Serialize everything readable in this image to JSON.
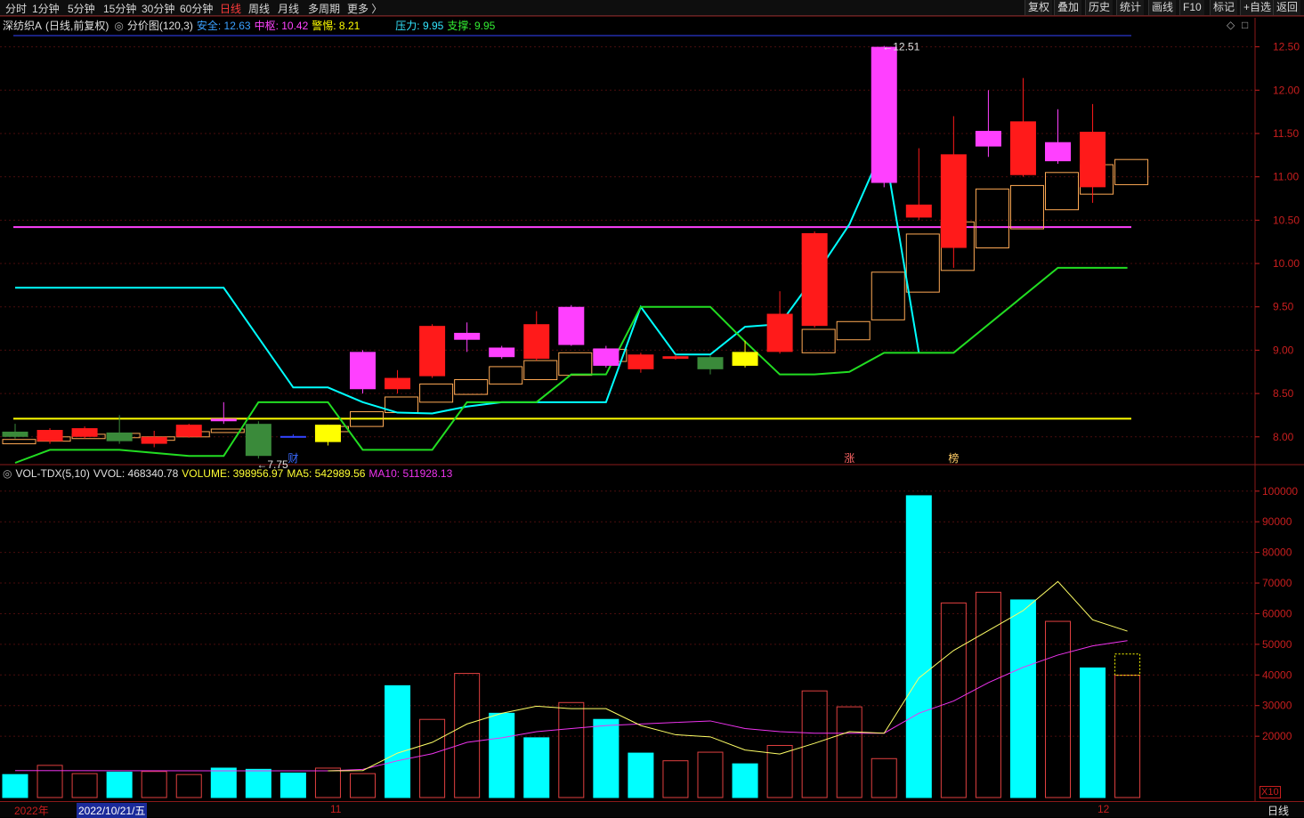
{
  "periods": [
    "分时",
    "1分钟",
    "5分钟",
    "15分钟",
    "30分钟",
    "60分钟",
    "日线",
    "周线",
    "月线",
    "多周期",
    "更多 〉"
  ],
  "active_period": "日线",
  "tools": [
    "复权",
    "叠加",
    "历史",
    "统计",
    "画线",
    "F10",
    "标记",
    "+自选",
    "返回"
  ],
  "info": {
    "stock": "深纺织A",
    "adjust": "(日线,前复权)",
    "indicator": "分价图(120,3)",
    "safe_label": "安全: 12.63",
    "mid_label": "中枢: 10.42",
    "warn_label": "警惕: 8.21",
    "press_label": "压力: 9.95",
    "support_label": "支撑: 9.95"
  },
  "vol_info": {
    "name": "VOL-TDX(5,10)",
    "vvol": "VVOL: 468340.78",
    "volume": "VOLUME: 398956.97",
    "ma5": "MA5: 542989.56",
    "ma10": "MA10: 511928.13"
  },
  "dates": {
    "year": "2022年",
    "selected": "2022/10/21/五",
    "nov": "11",
    "dec": "12"
  },
  "corner": {
    "multiplier": "X10",
    "period": "日线"
  },
  "colors": {
    "up": "#ff1a1a",
    "down": "#3a8a3a",
    "magenta": "#ff40ff",
    "yellow": "#ffff00",
    "cyan": "#00ffff",
    "green": "#22dd22",
    "blue": "#3344ff",
    "ma5": "#ffff66",
    "ma10": "#ee33ee",
    "box": "#ffaa55"
  },
  "chart_data": {
    "type": "candlestick",
    "price_axis": {
      "ylim": [
        7.7,
        12.65
      ],
      "ticks": [
        "12.50",
        "12.00",
        "11.50",
        "11.00",
        "10.50",
        "10.00",
        "9.50",
        "9.00",
        "8.50",
        "8.00"
      ]
    },
    "volume_axis": {
      "ylim": [
        0,
        104000
      ],
      "ticks": [
        "100000",
        "90000",
        "80000",
        "70000",
        "60000",
        "50000",
        "40000",
        "30000",
        "20000"
      ]
    },
    "levels": {
      "safe": 12.63,
      "mid": 10.42,
      "warn": 8.21
    },
    "annotations": {
      "low": "←7.75",
      "high": "←12.51",
      "markers": [
        "财",
        "涨",
        "榜"
      ]
    },
    "candles": [
      {
        "o": 8.0,
        "c": 8.06,
        "h": 8.15,
        "l": 7.98,
        "color": "down"
      },
      {
        "o": 7.95,
        "c": 8.08,
        "h": 8.1,
        "l": 7.92,
        "color": "up"
      },
      {
        "o": 8.0,
        "c": 8.1,
        "h": 8.12,
        "l": 7.98,
        "color": "up"
      },
      {
        "o": 8.05,
        "c": 7.95,
        "h": 8.25,
        "l": 7.92,
        "color": "down"
      },
      {
        "o": 7.92,
        "c": 8.0,
        "h": 8.07,
        "l": 7.88,
        "color": "up"
      },
      {
        "o": 8.0,
        "c": 8.14,
        "h": 8.15,
        "l": 7.99,
        "color": "up"
      },
      {
        "o": 8.18,
        "c": 8.21,
        "h": 8.4,
        "l": 8.15,
        "color": "magenta"
      },
      {
        "o": 8.15,
        "c": 7.78,
        "h": 8.18,
        "l": 7.75,
        "color": "down"
      },
      {
        "o": 8.0,
        "c": 8.01,
        "h": 8.03,
        "l": 7.99,
        "color": "blue"
      },
      {
        "o": 7.94,
        "c": 8.14,
        "h": 8.14,
        "l": 7.9,
        "color": "yellow"
      },
      {
        "o": 8.55,
        "c": 8.98,
        "h": 9.0,
        "l": 8.5,
        "color": "magenta"
      },
      {
        "o": 8.55,
        "c": 8.68,
        "h": 8.77,
        "l": 8.5,
        "color": "up"
      },
      {
        "o": 8.7,
        "c": 9.28,
        "h": 9.3,
        "l": 8.68,
        "color": "up"
      },
      {
        "o": 9.12,
        "c": 9.2,
        "h": 9.32,
        "l": 8.98,
        "color": "magenta"
      },
      {
        "o": 8.92,
        "c": 9.03,
        "h": 9.05,
        "l": 8.9,
        "color": "magenta"
      },
      {
        "o": 8.9,
        "c": 9.3,
        "h": 9.45,
        "l": 8.88,
        "color": "up"
      },
      {
        "o": 9.06,
        "c": 9.5,
        "h": 9.52,
        "l": 9.05,
        "color": "magenta"
      },
      {
        "o": 8.82,
        "c": 9.02,
        "h": 9.05,
        "l": 8.8,
        "color": "magenta"
      },
      {
        "o": 8.78,
        "c": 8.95,
        "h": 8.97,
        "l": 8.74,
        "color": "up"
      },
      {
        "o": 8.9,
        "c": 8.93,
        "h": 8.95,
        "l": 8.89,
        "color": "up"
      },
      {
        "o": 8.92,
        "c": 8.78,
        "h": 8.94,
        "l": 8.72,
        "color": "down"
      },
      {
        "o": 8.82,
        "c": 8.98,
        "h": 9.11,
        "l": 8.8,
        "color": "yellow"
      },
      {
        "o": 8.98,
        "c": 9.42,
        "h": 9.68,
        "l": 8.96,
        "color": "up"
      },
      {
        "o": 9.28,
        "c": 10.35,
        "h": 10.37,
        "l": 9.26,
        "color": "up"
      },
      {
        "o": 9.5,
        "c": 9.5,
        "h": 9.5,
        "l": 9.5,
        "color": "none"
      },
      {
        "o": 10.93,
        "c": 12.5,
        "h": 12.51,
        "l": 10.88,
        "color": "magenta"
      },
      {
        "o": 10.53,
        "c": 10.68,
        "h": 11.33,
        "l": 10.5,
        "color": "up"
      },
      {
        "o": 10.18,
        "c": 11.26,
        "h": 11.7,
        "l": 9.95,
        "color": "up"
      },
      {
        "o": 11.35,
        "c": 11.53,
        "h": 12.0,
        "l": 11.23,
        "color": "magenta"
      },
      {
        "o": 11.02,
        "c": 11.64,
        "h": 12.14,
        "l": 11.0,
        "color": "up"
      },
      {
        "o": 11.18,
        "c": 11.4,
        "h": 11.78,
        "l": 11.15,
        "color": "magenta"
      },
      {
        "o": 10.88,
        "c": 11.52,
        "h": 11.84,
        "l": 10.7,
        "color": "up"
      }
    ],
    "boxes": [
      {
        "lo": 7.92,
        "hi": 7.97
      },
      {
        "lo": 7.95,
        "hi": 8.0
      },
      {
        "lo": 7.98,
        "hi": 8.03
      },
      {
        "lo": 7.99,
        "hi": 8.04
      },
      {
        "lo": 7.96,
        "hi": 8.0
      },
      {
        "lo": 8.0,
        "hi": 8.06
      },
      {
        "lo": 8.05,
        "hi": 8.09
      },
      null,
      null,
      {
        "lo": 8.06,
        "hi": 8.12
      },
      {
        "lo": 8.12,
        "hi": 8.29
      },
      {
        "lo": 8.28,
        "hi": 8.46
      },
      {
        "lo": 8.4,
        "hi": 8.61
      },
      {
        "lo": 8.49,
        "hi": 8.66
      },
      {
        "lo": 8.61,
        "hi": 8.81
      },
      {
        "lo": 8.66,
        "hi": 8.88
      },
      {
        "lo": 8.71,
        "hi": 8.97
      },
      {
        "lo": 8.87,
        "hi": 9.01
      },
      null,
      null,
      null,
      null,
      null,
      {
        "lo": 8.97,
        "hi": 9.24
      },
      {
        "lo": 9.12,
        "hi": 9.33
      },
      {
        "lo": 9.35,
        "hi": 9.9
      },
      {
        "lo": 9.67,
        "hi": 10.34
      },
      {
        "lo": 9.92,
        "hi": 10.48
      },
      {
        "lo": 10.18,
        "hi": 10.86
      },
      {
        "lo": 10.4,
        "hi": 10.9
      },
      {
        "lo": 10.62,
        "hi": 11.05
      },
      {
        "lo": 10.8,
        "hi": 11.14
      },
      {
        "lo": 10.91,
        "hi": 11.2
      }
    ],
    "cyan_line": [
      {
        "x": 0,
        "y": 9.72
      },
      {
        "x": 6,
        "y": 9.72
      },
      {
        "x": 8,
        "y": 8.57
      },
      {
        "x": 9,
        "y": 8.57
      },
      {
        "x": 10,
        "y": 8.4
      },
      {
        "x": 11,
        "y": 8.28
      },
      {
        "x": 12,
        "y": 8.27
      },
      {
        "x": 13,
        "y": 8.35
      },
      {
        "x": 14,
        "y": 8.4
      },
      {
        "x": 15,
        "y": 8.4
      },
      {
        "x": 16,
        "y": 8.4
      },
      {
        "x": 17,
        "y": 8.4
      },
      {
        "x": 18,
        "y": 9.5
      },
      {
        "x": 19,
        "y": 8.95
      },
      {
        "x": 20,
        "y": 8.95
      },
      {
        "x": 21,
        "y": 9.27
      },
      {
        "x": 22,
        "y": 9.3
      },
      {
        "x": 23,
        "y": 9.85
      },
      {
        "x": 24,
        "y": 10.45
      },
      {
        "x": 25,
        "y": 11.36
      },
      {
        "x": 26,
        "y": 8.97
      }
    ],
    "green_line": [
      {
        "x": 0,
        "y": 7.7
      },
      {
        "x": 1,
        "y": 7.85
      },
      {
        "x": 3,
        "y": 7.85
      },
      {
        "x": 5,
        "y": 7.78
      },
      {
        "x": 6,
        "y": 7.78
      },
      {
        "x": 7,
        "y": 8.4
      },
      {
        "x": 9,
        "y": 8.4
      },
      {
        "x": 10,
        "y": 7.85
      },
      {
        "x": 12,
        "y": 7.85
      },
      {
        "x": 13,
        "y": 8.4
      },
      {
        "x": 15,
        "y": 8.4
      },
      {
        "x": 16,
        "y": 8.72
      },
      {
        "x": 17,
        "y": 8.72
      },
      {
        "x": 18,
        "y": 9.5
      },
      {
        "x": 20,
        "y": 9.5
      },
      {
        "x": 21,
        "y": 9.1
      },
      {
        "x": 22,
        "y": 8.72
      },
      {
        "x": 23,
        "y": 8.72
      },
      {
        "x": 24,
        "y": 8.75
      },
      {
        "x": 25,
        "y": 8.97
      },
      {
        "x": 26,
        "y": 8.97
      },
      {
        "x": 27,
        "y": 8.97
      },
      {
        "x": 30,
        "y": 9.95
      },
      {
        "x": 32,
        "y": 9.95
      }
    ],
    "volume": [
      {
        "v": 7500,
        "color": "cyan",
        "fill": true
      },
      {
        "v": 10500,
        "color": "red",
        "fill": false
      },
      {
        "v": 7800,
        "color": "red",
        "fill": false
      },
      {
        "v": 8300,
        "color": "cyan",
        "fill": true
      },
      {
        "v": 8500,
        "color": "red",
        "fill": false
      },
      {
        "v": 7500,
        "color": "red",
        "fill": false
      },
      {
        "v": 9600,
        "color": "cyan",
        "fill": true
      },
      {
        "v": 9200,
        "color": "cyan",
        "fill": true
      },
      {
        "v": 8000,
        "color": "cyan",
        "fill": true
      },
      {
        "v": 9600,
        "color": "red",
        "fill": false
      },
      {
        "v": 7800,
        "color": "red",
        "fill": false
      },
      {
        "v": 36500,
        "color": "cyan",
        "fill": true
      },
      {
        "v": 25500,
        "color": "red",
        "fill": false
      },
      {
        "v": 40500,
        "color": "red",
        "fill": false
      },
      {
        "v": 27500,
        "color": "cyan",
        "fill": true
      },
      {
        "v": 19500,
        "color": "cyan",
        "fill": true
      },
      {
        "v": 31000,
        "color": "red",
        "fill": false
      },
      {
        "v": 25500,
        "color": "cyan",
        "fill": true
      },
      {
        "v": 14500,
        "color": "cyan",
        "fill": true
      },
      {
        "v": 12000,
        "color": "red",
        "fill": false
      },
      {
        "v": 14800,
        "color": "red",
        "fill": false
      },
      {
        "v": 11000,
        "color": "cyan",
        "fill": true
      },
      {
        "v": 17000,
        "color": "red",
        "fill": false
      },
      {
        "v": 34800,
        "color": "red",
        "fill": false
      },
      {
        "v": 29600,
        "color": "red",
        "fill": false
      },
      {
        "v": 12700,
        "color": "red",
        "fill": false
      },
      {
        "v": 98500,
        "color": "cyan",
        "fill": true
      },
      {
        "v": 63500,
        "color": "red",
        "fill": false
      },
      {
        "v": 67000,
        "color": "red",
        "fill": false
      },
      {
        "v": 64500,
        "color": "cyan",
        "fill": true
      },
      {
        "v": 57500,
        "color": "red",
        "fill": false
      },
      {
        "v": 42300,
        "color": "cyan",
        "fill": true
      },
      {
        "v": 39900,
        "color": "red",
        "fill": false
      }
    ],
    "vvol": 46834,
    "ma5": [
      {
        "x": 9,
        "v": 8700
      },
      {
        "x": 10,
        "v": 8800
      },
      {
        "x": 11,
        "v": 14500
      },
      {
        "x": 12,
        "v": 18000
      },
      {
        "x": 13,
        "v": 24000
      },
      {
        "x": 14,
        "v": 27500
      },
      {
        "x": 15,
        "v": 29800
      },
      {
        "x": 16,
        "v": 29000
      },
      {
        "x": 17,
        "v": 29000
      },
      {
        "x": 18,
        "v": 23500
      },
      {
        "x": 19,
        "v": 20500
      },
      {
        "x": 20,
        "v": 19800
      },
      {
        "x": 21,
        "v": 15500
      },
      {
        "x": 22,
        "v": 14200
      },
      {
        "x": 23,
        "v": 17700
      },
      {
        "x": 24,
        "v": 21500
      },
      {
        "x": 25,
        "v": 21000
      },
      {
        "x": 26,
        "v": 39000
      },
      {
        "x": 27,
        "v": 48000
      },
      {
        "x": 28,
        "v": 54500
      },
      {
        "x": 29,
        "v": 61000
      },
      {
        "x": 30,
        "v": 70500
      },
      {
        "x": 31,
        "v": 58000
      },
      {
        "x": 32,
        "v": 54300
      }
    ],
    "ma10": [
      {
        "x": 0,
        "v": 8800
      },
      {
        "x": 9,
        "v": 8700
      },
      {
        "x": 10,
        "v": 9200
      },
      {
        "x": 11,
        "v": 12000
      },
      {
        "x": 12,
        "v": 14300
      },
      {
        "x": 13,
        "v": 18000
      },
      {
        "x": 14,
        "v": 19500
      },
      {
        "x": 15,
        "v": 21500
      },
      {
        "x": 16,
        "v": 22500
      },
      {
        "x": 17,
        "v": 23500
      },
      {
        "x": 18,
        "v": 24000
      },
      {
        "x": 19,
        "v": 24500
      },
      {
        "x": 20,
        "v": 25000
      },
      {
        "x": 21,
        "v": 22500
      },
      {
        "x": 22,
        "v": 21500
      },
      {
        "x": 23,
        "v": 21000
      },
      {
        "x": 24,
        "v": 21000
      },
      {
        "x": 25,
        "v": 21000
      },
      {
        "x": 26,
        "v": 27500
      },
      {
        "x": 27,
        "v": 31500
      },
      {
        "x": 28,
        "v": 37500
      },
      {
        "x": 29,
        "v": 42500
      },
      {
        "x": 30,
        "v": 46500
      },
      {
        "x": 31,
        "v": 49500
      },
      {
        "x": 32,
        "v": 51200
      }
    ]
  }
}
